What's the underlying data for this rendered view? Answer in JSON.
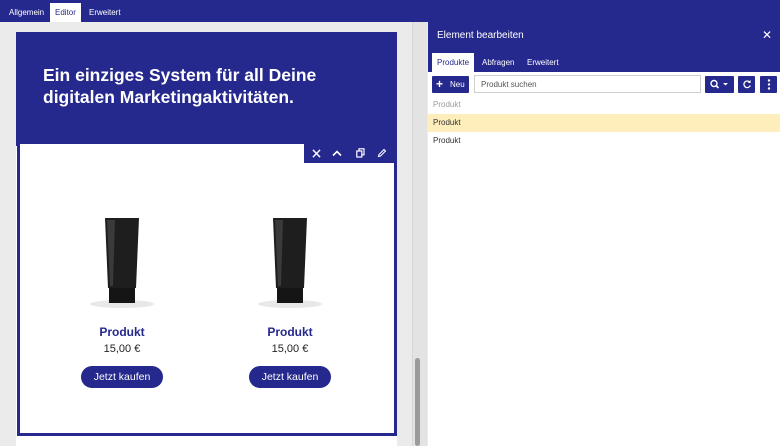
{
  "top_tabs": [
    {
      "label": "Allgemein",
      "active": false
    },
    {
      "label": "Editor",
      "active": true
    },
    {
      "label": "Erweitert",
      "active": false
    }
  ],
  "hero": {
    "headline": "Ein einziges System für all Deine digitalen Marketingaktivitäten."
  },
  "block_toolbar": {
    "icons": [
      "close-icon",
      "chevron-up-icon",
      "copy-icon",
      "pencil-icon"
    ]
  },
  "products": [
    {
      "name": "Produkt",
      "price": "15,00 €",
      "button": "Jetzt kaufen"
    },
    {
      "name": "Produkt",
      "price": "15,00 €",
      "button": "Jetzt kaufen"
    }
  ],
  "panel": {
    "title": "Element bearbeiten",
    "tabs": [
      {
        "label": "Produkte",
        "active": true
      },
      {
        "label": "Abfragen",
        "active": false
      },
      {
        "label": "Erweitert",
        "active": false
      }
    ],
    "new_button": "Neu",
    "search_placeholder": "Produkt suchen",
    "list_header": "Produkt",
    "rows": [
      {
        "label": "Produkt",
        "selected": true
      },
      {
        "label": "Produkt",
        "selected": false
      }
    ]
  },
  "colors": {
    "brand": "#25288c",
    "selected_row": "#fdeebb"
  }
}
